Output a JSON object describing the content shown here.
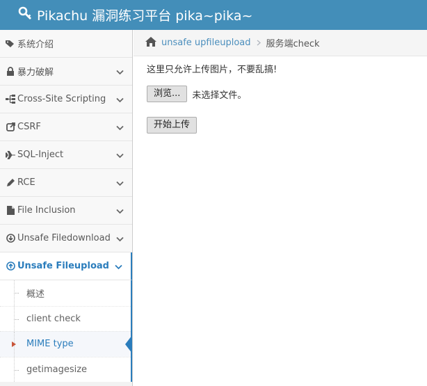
{
  "navbar": {
    "brand": "Pikachu 漏洞练习平台 pika~pika~",
    "brand_icon": "key-icon"
  },
  "sidebar": {
    "items": [
      {
        "label": "系统介绍",
        "icon": "tags-icon"
      },
      {
        "label": "暴力破解",
        "icon": "lock-icon"
      },
      {
        "label": "Cross-Site Scripting",
        "icon": "sitemap-icon"
      },
      {
        "label": "CSRF",
        "icon": "external-link-icon"
      },
      {
        "label": "SQL-Inject",
        "icon": "plane-icon"
      },
      {
        "label": "RCE",
        "icon": "pencil-icon"
      },
      {
        "label": "File Inclusion",
        "icon": "file-icon"
      },
      {
        "label": "Unsafe Filedownload",
        "icon": "download-circle-icon"
      },
      {
        "label": "Unsafe Fileupload",
        "icon": "upload-circle-icon"
      }
    ],
    "submenu": [
      {
        "label": "概述"
      },
      {
        "label": "client check"
      },
      {
        "label": "MIME type"
      },
      {
        "label": "getimagesize"
      }
    ]
  },
  "breadcrumb": {
    "home_icon": "home-icon",
    "link": "unsafe upfileupload",
    "current": "服务端check"
  },
  "content": {
    "notice": "这里只允许上传图片，不要乱搞!",
    "browse_label": "浏览...",
    "file_status": "未选择文件。",
    "upload_label": "开始上传"
  },
  "colors": {
    "navbar": "#438eb9",
    "accent": "#2b7dbc",
    "caret": "#c8553a"
  }
}
